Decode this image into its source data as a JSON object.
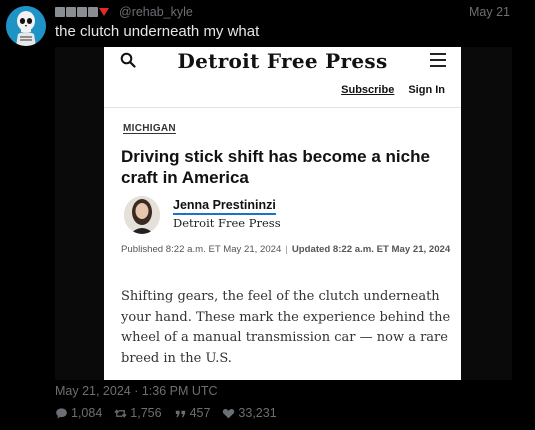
{
  "tweet": {
    "handle": "@rehab_kyle",
    "date": "May 21",
    "text": "the clutch underneath my what",
    "timestamp": "May 21, 2024 · 1:36 PM UTC",
    "stats": {
      "replies": "1,084",
      "retweets": "1,756",
      "quotes": "457",
      "likes": "33,231"
    },
    "avatar_icon": "skull-icon",
    "flag_color": "#e02b2b"
  },
  "article": {
    "masthead": "Detroit Free Press",
    "subscribe": "Subscribe",
    "sign_in": "Sign In",
    "section": "MICHIGAN",
    "headline": "Driving stick shift has become a niche craft in America",
    "author": "Jenna Prestininzi",
    "author_org": "Detroit Free Press",
    "published": "Published 8:22 a.m. ET May 21, 2024",
    "updated": "Updated 8:22 a.m. ET May 21, 2024",
    "body": "Shifting gears, the feel of the clutch underneath your hand. These mark the experience behind the wheel of a manual transmission car — now a rare breed in the U.S."
  }
}
